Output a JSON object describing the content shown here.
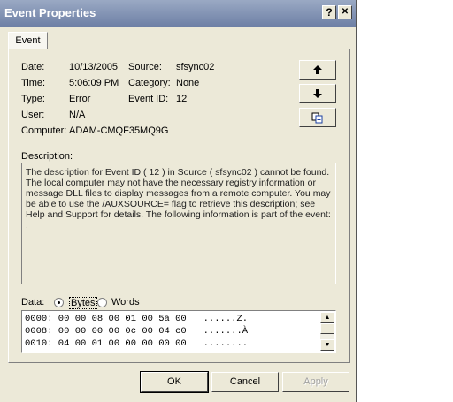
{
  "window": {
    "title": "Event Properties",
    "help_glyph": "?",
    "close_glyph": "✕"
  },
  "tabs": [
    {
      "label": "Event"
    }
  ],
  "fields": {
    "date_label": "Date:",
    "date": "10/13/2005",
    "time_label": "Time:",
    "time": "5:06:09 PM",
    "type_label": "Type:",
    "type": "Error",
    "user_label": "User:",
    "user": "N/A",
    "computer_label": "Computer:",
    "computer": "ADAM-CMQF35MQ9G",
    "source_label": "Source:",
    "source": "sfsync02",
    "category_label": "Category:",
    "category": "None",
    "eventid_label": "Event ID:",
    "eventid": "12"
  },
  "description": {
    "label": "Description:",
    "text": "The description for Event ID ( 12 ) in Source ( sfsync02 ) cannot be found. The local computer may not have the necessary registry information or message DLL files to display messages from a remote computer. You may be able to use the /AUXSOURCE= flag to retrieve this description; see Help and Support for details. The following information is part of the event: ."
  },
  "data": {
    "label": "Data:",
    "bytes_label": "Bytes",
    "words_label": "Words",
    "selected": "Bytes",
    "rows": [
      "0000: 00 00 08 00 01 00 5a 00   ......Z.",
      "0008: 00 00 00 00 0c 00 04 c0   .......À",
      "0010: 04 00 01 00 00 00 00 00   ........"
    ]
  },
  "side_buttons": {
    "up_icon": "arrow-up-icon",
    "down_icon": "arrow-down-icon",
    "copy_icon": "copy-icon"
  },
  "buttons": {
    "ok": "OK",
    "cancel": "Cancel",
    "apply": "Apply"
  }
}
